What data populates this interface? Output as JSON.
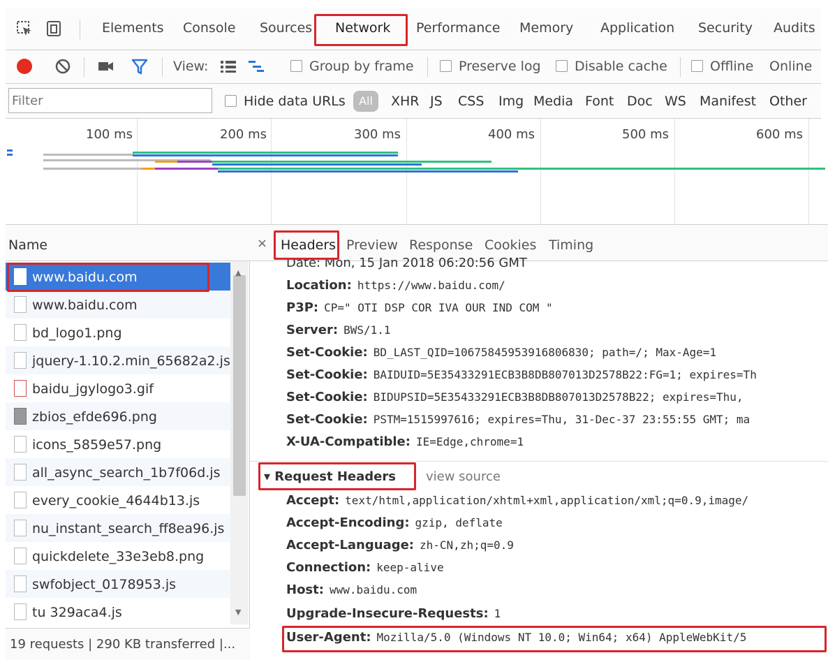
{
  "tabs": [
    "Elements",
    "Console",
    "Sources",
    "Network",
    "Performance",
    "Memory",
    "Application",
    "Security",
    "Audits"
  ],
  "active_tab": "Network",
  "toolbar": {
    "view_label": "View:",
    "group_by_frame": "Group by frame",
    "preserve_log": "Preserve log",
    "disable_cache": "Disable cache",
    "offline": "Offline",
    "online": "Online"
  },
  "filter": {
    "placeholder": "Filter",
    "hide_data_urls": "Hide data URLs",
    "all": "All",
    "types": [
      "XHR",
      "JS",
      "CSS",
      "Img",
      "Media",
      "Font",
      "Doc",
      "WS",
      "Manifest",
      "Other"
    ]
  },
  "timeline": {
    "ticks": [
      "100 ms",
      "200 ms",
      "300 ms",
      "400 ms",
      "500 ms",
      "600 ms"
    ]
  },
  "requests": {
    "name_header": "Name",
    "items": [
      "www.baidu.com",
      "www.baidu.com",
      "bd_logo1.png",
      "jquery-1.10.2.min_65682a2.js",
      "baidu_jgylogo3.gif",
      "zbios_efde696.png",
      "icons_5859e57.png",
      "all_async_search_1b7f06d.js",
      "every_cookie_4644b13.js",
      "nu_instant_search_ff8ea96.js",
      "quickdelete_33e3eb8.png",
      "swfobject_0178953.js",
      "tu 329aca4.js"
    ],
    "selected_index": 0,
    "status": "19 requests  |  290 KB transferred  |..."
  },
  "detail": {
    "close": "×",
    "tabs": [
      "Headers",
      "Preview",
      "Response",
      "Cookies",
      "Timing"
    ],
    "active_tab": "Headers",
    "cutoff_line": "Date: Mon, 15 Jan 2018 06:20:56 GMT",
    "response_headers": [
      {
        "key": "Location:",
        "value": "https://www.baidu.com/"
      },
      {
        "key": "P3P:",
        "value": "CP=\" OTI DSP COR IVA OUR IND COM \""
      },
      {
        "key": "Server:",
        "value": "BWS/1.1"
      },
      {
        "key": "Set-Cookie:",
        "value": "BD_LAST_QID=10675845953916806830; path=/; Max-Age=1"
      },
      {
        "key": "Set-Cookie:",
        "value": "BAIDUID=5E35433291ECB3B8DB807013D2578B22:FG=1; expires=Th"
      },
      {
        "key": "Set-Cookie:",
        "value": "BIDUPSID=5E35433291ECB3B8DB807013D2578B22; expires=Thu,"
      },
      {
        "key": "Set-Cookie:",
        "value": "PSTM=1515997616; expires=Thu, 31-Dec-37 23:55:55 GMT; ma"
      },
      {
        "key": "X-UA-Compatible:",
        "value": "IE=Edge,chrome=1"
      }
    ],
    "request_section_title": "▾ Request Headers",
    "view_source": "view source",
    "request_headers": [
      {
        "key": "Accept:",
        "value": "text/html,application/xhtml+xml,application/xml;q=0.9,image/"
      },
      {
        "key": "Accept-Encoding:",
        "value": "gzip, deflate"
      },
      {
        "key": "Accept-Language:",
        "value": "zh-CN,zh;q=0.9"
      },
      {
        "key": "Connection:",
        "value": "keep-alive"
      },
      {
        "key": "Host:",
        "value": "www.baidu.com"
      },
      {
        "key": "Upgrade-Insecure-Requests:",
        "value": "1"
      },
      {
        "key": "User-Agent:",
        "value": "Mozilla/5.0 (Windows NT 10.0; Win64; x64) AppleWebKit/5"
      }
    ]
  },
  "colors": {
    "highlight": "#d6262b",
    "selected_row": "#3879d9",
    "record": "#e52b20",
    "filter_icon": "#2a74d8"
  }
}
